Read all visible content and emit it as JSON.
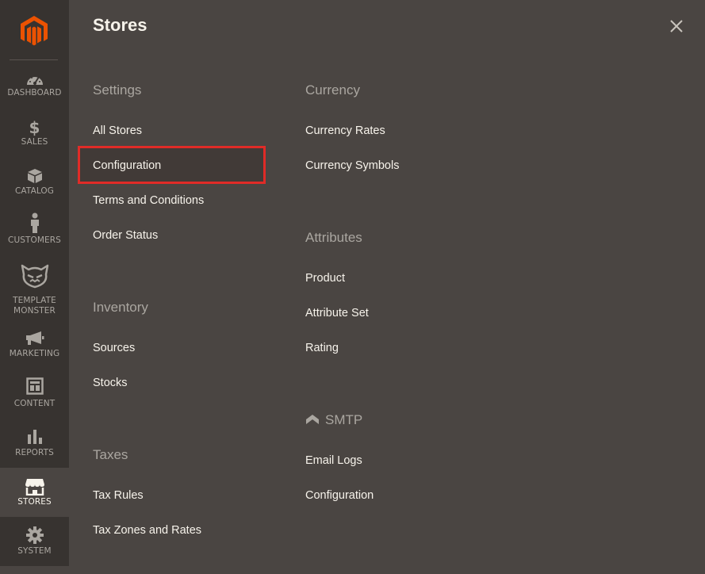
{
  "sidebar": {
    "items": [
      {
        "label": "DASHBOARD",
        "icon": "dashboard-icon"
      },
      {
        "label": "SALES",
        "icon": "dollar-icon"
      },
      {
        "label": "CATALOG",
        "icon": "box-icon"
      },
      {
        "label": "CUSTOMERS",
        "icon": "person-icon"
      },
      {
        "label": "TEMPLATE",
        "label2": "MONSTER",
        "icon": "template-monster-icon"
      },
      {
        "label": "MARKETING",
        "icon": "megaphone-icon"
      },
      {
        "label": "CONTENT",
        "icon": "layout-icon"
      },
      {
        "label": "REPORTS",
        "icon": "bar-chart-icon"
      },
      {
        "label": "STORES",
        "icon": "store-icon",
        "active": true
      },
      {
        "label": "SYSTEM",
        "icon": "gear-icon"
      }
    ]
  },
  "panel": {
    "title": "Stores",
    "settings": {
      "heading": "Settings",
      "links": [
        "All Stores",
        "Configuration",
        "Terms and Conditions",
        "Order Status"
      ]
    },
    "inventory": {
      "heading": "Inventory",
      "links": [
        "Sources",
        "Stocks"
      ]
    },
    "taxes": {
      "heading": "Taxes",
      "links": [
        "Tax Rules",
        "Tax Zones and Rates"
      ]
    },
    "currency": {
      "heading": "Currency",
      "links": [
        "Currency Rates",
        "Currency Symbols"
      ]
    },
    "attributes": {
      "heading": "Attributes",
      "links": [
        "Product",
        "Attribute Set",
        "Rating"
      ]
    },
    "smtp": {
      "heading": "SMTP",
      "links": [
        "Email Logs",
        "Configuration"
      ]
    }
  },
  "colors": {
    "sidebar_bg": "#373330",
    "panel_bg": "#4a4542",
    "logo_orange": "#eb5202",
    "highlight_border": "#e02b27",
    "text_light": "#f7f3eb",
    "text_muted": "#aaa6a0"
  }
}
